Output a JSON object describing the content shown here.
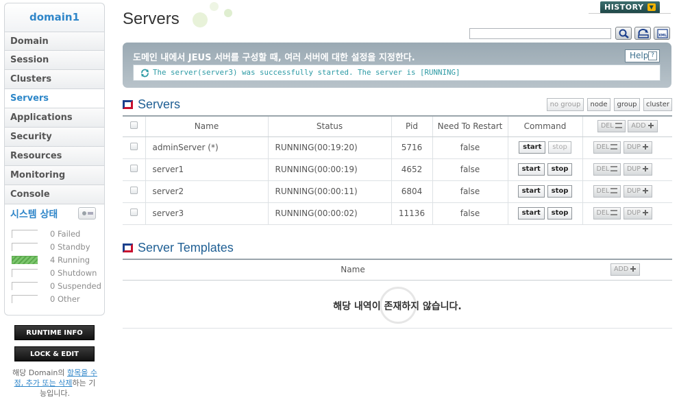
{
  "sidebar": {
    "domain_name": "domain1",
    "nav": [
      {
        "label": "Domain"
      },
      {
        "label": "Session"
      },
      {
        "label": "Clusters"
      },
      {
        "label": "Servers",
        "active": true
      },
      {
        "label": "Applications"
      },
      {
        "label": "Security"
      },
      {
        "label": "Resources"
      },
      {
        "label": "Monitoring"
      },
      {
        "label": "Console"
      }
    ],
    "status": {
      "title": "시스템 상태",
      "rows": [
        {
          "count": "0",
          "label": "Failed"
        },
        {
          "count": "0",
          "label": "Standby"
        },
        {
          "count": "4",
          "label": "Running"
        },
        {
          "count": "0",
          "label": "Shutdown"
        },
        {
          "count": "0",
          "label": "Suspended"
        },
        {
          "count": "0",
          "label": "Other"
        }
      ]
    },
    "runtime_info_label": "RUNTIME INFO",
    "lock_edit_label": "LOCK & EDIT",
    "lock_note": {
      "prefix": "해당 Domain의 ",
      "link": "항목을 수정, 추가 또는 삭제",
      "suffix": "하는 기능입니다."
    }
  },
  "header": {
    "title": "Servers",
    "history_label": "HISTORY",
    "search_value": ""
  },
  "info": {
    "description": "도메인 내에서 JEUS 서버를 구성할 때, 여러 서버에 대한 설정을 지정한다.",
    "help_label": "Help",
    "message": "The server(server3) was successfully started. The server is [RUNNING]"
  },
  "servers_section": {
    "title": "Servers",
    "filters": [
      "no group",
      "node",
      "group",
      "cluster"
    ],
    "columns": {
      "name": "Name",
      "status": "Status",
      "pid": "Pid",
      "restart": "Need To Restart",
      "command": "Command"
    },
    "del_label": "DEL",
    "add_label": "ADD",
    "dup_label": "DUP",
    "start_label": "start",
    "stop_label": "stop",
    "rows": [
      {
        "name": "adminServer (*)",
        "status": "RUNNING(00:19:20)",
        "pid": "5716",
        "restart": "false"
      },
      {
        "name": "server1",
        "status": "RUNNING(00:00:19)",
        "pid": "4652",
        "restart": "false"
      },
      {
        "name": "server2",
        "status": "RUNNING(00:00:11)",
        "pid": "6804",
        "restart": "false"
      },
      {
        "name": "server3",
        "status": "RUNNING(00:00:02)",
        "pid": "11136",
        "restart": "false"
      }
    ]
  },
  "templates_section": {
    "title": "Server Templates",
    "column_name": "Name",
    "add_label": "ADD",
    "empty_message": "해당 내역이 존재하지 않습니다."
  }
}
